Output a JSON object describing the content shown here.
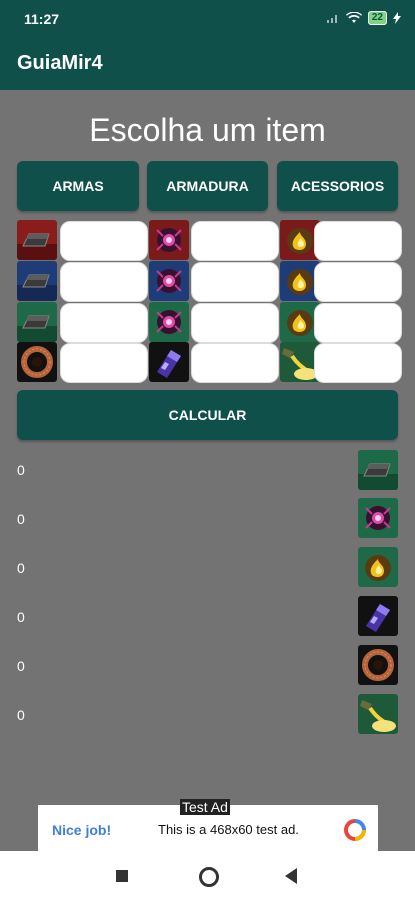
{
  "status_bar": {
    "time": "11:27",
    "battery": "22"
  },
  "app_bar": {
    "title": "GuiaMir4"
  },
  "heading": "Escolha um item",
  "tabs": [
    {
      "label": "ARMAS"
    },
    {
      "label": "ARMADURA"
    },
    {
      "label": "ACESSORIOS"
    }
  ],
  "grid_icons": {
    "col1": [
      "ingot-red-icon",
      "ingot-blue-icon",
      "ingot-green-icon",
      "copper-coil-icon"
    ],
    "col2": [
      "energy-orb-red-icon",
      "energy-orb-blue-icon",
      "energy-orb-green-icon",
      "purple-crystal-icon"
    ],
    "col3": [
      "golden-flame-red-icon",
      "golden-flame-blue-icon",
      "golden-flame-green-icon",
      "gold-pour-icon"
    ]
  },
  "calculate_label": "CALCULAR",
  "results": [
    {
      "value": "0",
      "icon": "ingot-icon"
    },
    {
      "value": "0",
      "icon": "energy-orb-icon"
    },
    {
      "value": "0",
      "icon": "golden-flame-icon"
    },
    {
      "value": "0",
      "icon": "purple-crystal-icon"
    },
    {
      "value": "0",
      "icon": "copper-coil-icon"
    },
    {
      "value": "0",
      "icon": "gold-pour-icon"
    }
  ],
  "ad": {
    "label": "Test Ad",
    "nice": "Nice job!",
    "text": "This is a 468x60 test ad."
  },
  "colors": {
    "primary": "#10504a",
    "background": "#737373"
  }
}
